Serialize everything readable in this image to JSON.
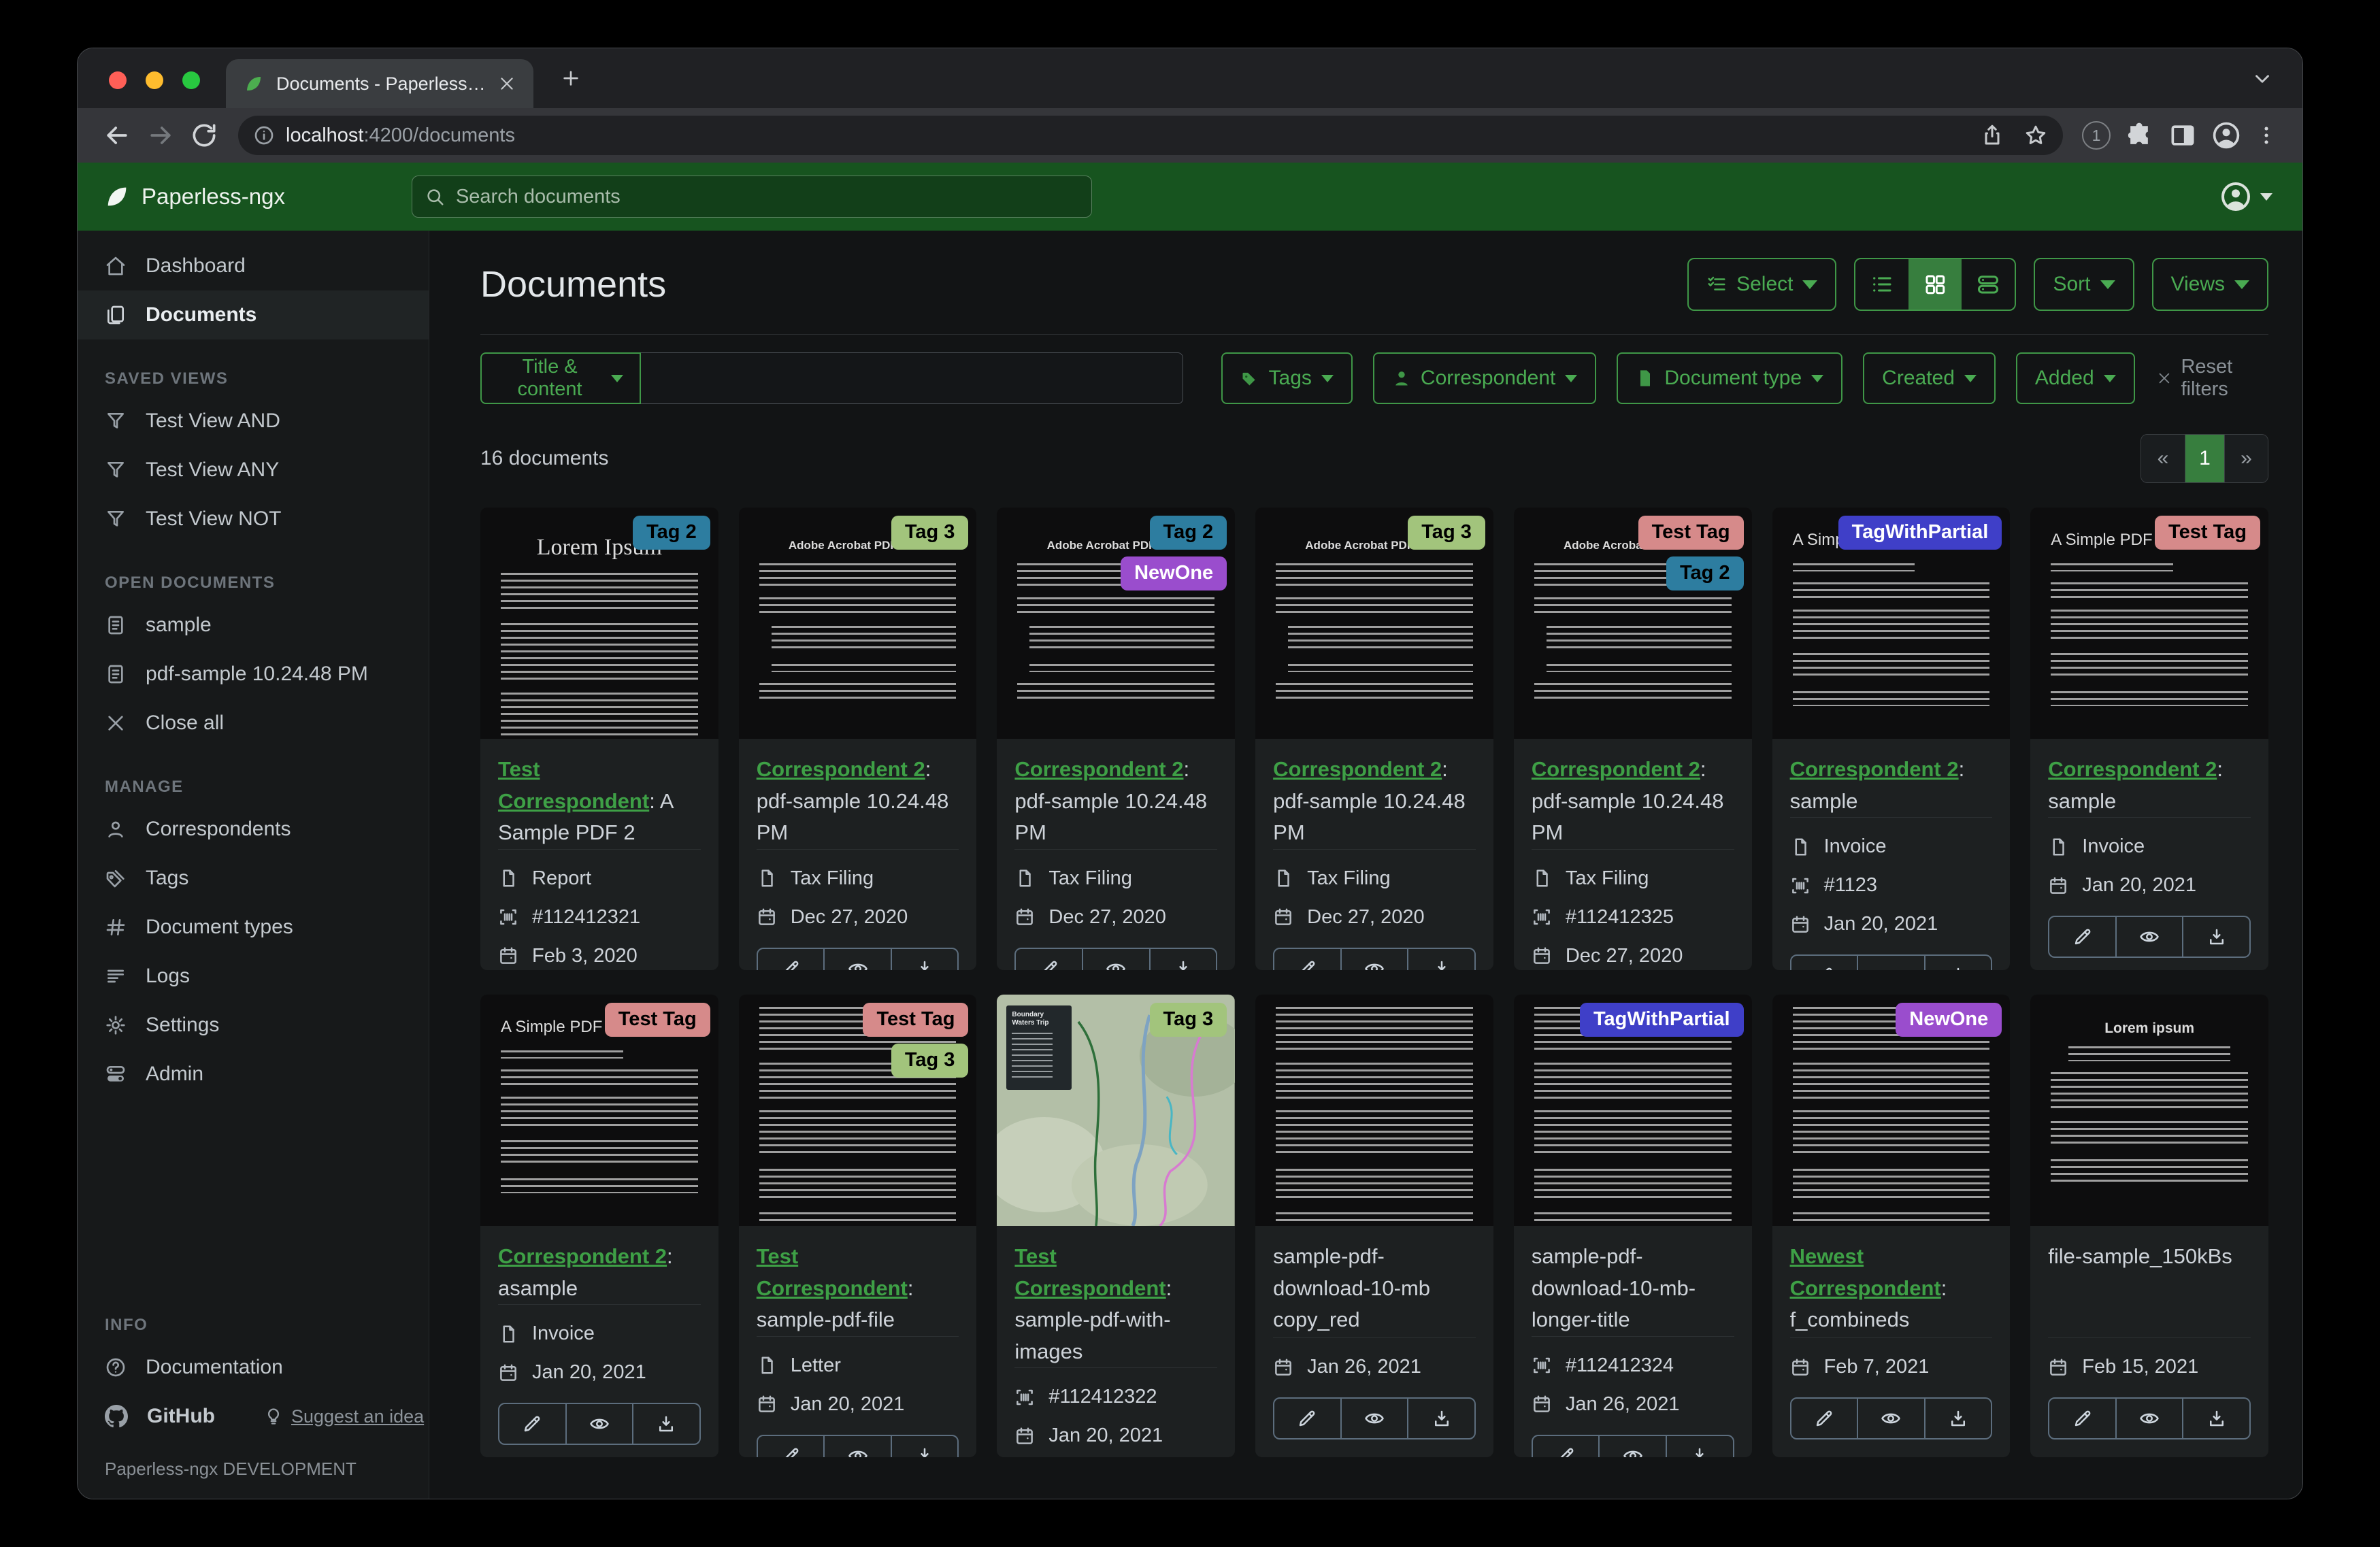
{
  "browser": {
    "tab_title": "Documents - Paperless-ngx",
    "url_host": "localhost",
    "url_rest": ":4200/documents",
    "ext_badge": "1"
  },
  "header": {
    "brand": "Paperless-ngx",
    "search_placeholder": "Search documents"
  },
  "sidebar": {
    "sections": [
      {
        "items": [
          {
            "icon": "home-icon",
            "label": "Dashboard"
          },
          {
            "icon": "documents-icon",
            "label": "Documents",
            "active": true
          }
        ]
      },
      {
        "title": "SAVED VIEWS",
        "items": [
          {
            "icon": "funnel-icon",
            "label": "Test View AND"
          },
          {
            "icon": "funnel-icon",
            "label": "Test View ANY"
          },
          {
            "icon": "funnel-icon",
            "label": "Test View NOT"
          }
        ]
      },
      {
        "title": "OPEN DOCUMENTS",
        "items": [
          {
            "icon": "file-text-icon",
            "label": "sample"
          },
          {
            "icon": "file-text-icon",
            "label": "pdf-sample 10.24.48 PM"
          },
          {
            "icon": "x-icon",
            "label": "Close all"
          }
        ]
      },
      {
        "title": "MANAGE",
        "items": [
          {
            "icon": "person-icon",
            "label": "Correspondents"
          },
          {
            "icon": "tags-icon",
            "label": "Tags"
          },
          {
            "icon": "hash-icon",
            "label": "Document types"
          },
          {
            "icon": "logs-icon",
            "label": "Logs"
          },
          {
            "icon": "gear-icon",
            "label": "Settings"
          },
          {
            "icon": "admin-icon",
            "label": "Admin"
          }
        ]
      }
    ],
    "info": {
      "title": "INFO",
      "documentation": {
        "icon": "question-icon",
        "label": "Documentation"
      },
      "github": {
        "icon": "github-icon",
        "label": "GitHub"
      },
      "suggest": {
        "icon": "bulb-icon",
        "label": "Suggest an idea"
      }
    },
    "footer": "Paperless-ngx DEVELOPMENT"
  },
  "toolbar": {
    "title": "Documents",
    "select_label": "Select",
    "sort_label": "Sort",
    "views_label": "Views"
  },
  "filters": {
    "field_label": "Title & content",
    "input_value": "",
    "buttons": [
      {
        "icon": "tag-filled-icon",
        "label": "Tags"
      },
      {
        "icon": "person-filled-icon",
        "label": "Correspondent"
      },
      {
        "icon": "file-filled-icon",
        "label": "Document type"
      },
      {
        "label": "Created"
      },
      {
        "label": "Added"
      }
    ],
    "reset_label": "Reset filters"
  },
  "status": {
    "count": "16 documents"
  },
  "pagination": {
    "prev": "«",
    "page": "1",
    "next": "»"
  },
  "theme": {
    "accent_green": "#43a047",
    "header_green": "#17541f",
    "active_green": "#377e3e"
  },
  "tag_colors": {
    "Tag 2": {
      "bg": "#2d7da0",
      "fg": "#000000"
    },
    "Tag 3": {
      "bg": "#a2c47c",
      "fg": "#000000"
    },
    "NewOne": {
      "bg": "#9a4dcd",
      "fg": "#ffffff"
    },
    "Test Tag": {
      "bg": "#d68a8a",
      "fg": "#000000"
    },
    "TagWithPartial": {
      "bg": "#3f3fc8",
      "fg": "#ffffff"
    }
  },
  "card_actions": [
    {
      "icon": "pencil-icon",
      "name": "edit-document-button"
    },
    {
      "icon": "eye-icon",
      "name": "view-document-button"
    },
    {
      "icon": "download-icon",
      "name": "download-document-button"
    }
  ],
  "cards": [
    {
      "tags": [
        "Tag 2"
      ],
      "thumb": {
        "kind": "lorem_serif",
        "heading": "Lorem Ipsum"
      },
      "title": {
        "link": "Test Correspondent",
        "rest": ": A Sample PDF 2"
      },
      "meta": [
        {
          "icon": "file-outline-icon",
          "text": "Report"
        },
        {
          "icon": "barcode-icon",
          "text": "#112412321"
        },
        {
          "icon": "calendar-icon",
          "text": "Feb 3, 2020"
        }
      ]
    },
    {
      "tags": [
        "Tag 3"
      ],
      "thumb": {
        "kind": "adobe",
        "heading": "Adobe Acrobat PDF Files"
      },
      "title": {
        "link": "Correspondent 2",
        "rest": ": pdf-sample 10.24.48 PM"
      },
      "meta": [
        {
          "icon": "file-outline-icon",
          "text": "Tax Filing"
        },
        {
          "icon": "calendar-icon",
          "text": "Dec 27, 2020"
        }
      ]
    },
    {
      "tags": [
        "Tag 2",
        "NewOne"
      ],
      "thumb": {
        "kind": "adobe",
        "heading": "Adobe Acrobat PDF Files"
      },
      "title": {
        "link": "Correspondent 2",
        "rest": ": pdf-sample 10.24.48 PM"
      },
      "meta": [
        {
          "icon": "file-outline-icon",
          "text": "Tax Filing"
        },
        {
          "icon": "calendar-icon",
          "text": "Dec 27, 2020"
        }
      ]
    },
    {
      "tags": [
        "Tag 3"
      ],
      "thumb": {
        "kind": "adobe",
        "heading": "Adobe Acrobat PDF Files"
      },
      "title": {
        "link": "Correspondent 2",
        "rest": ": pdf-sample 10.24.48 PM"
      },
      "meta": [
        {
          "icon": "file-outline-icon",
          "text": "Tax Filing"
        },
        {
          "icon": "calendar-icon",
          "text": "Dec 27, 2020"
        }
      ]
    },
    {
      "tags": [
        "Test Tag",
        "Tag 2"
      ],
      "thumb": {
        "kind": "adobe",
        "heading": "Adobe Acrobat PDF Files"
      },
      "title": {
        "link": "Correspondent 2",
        "rest": ": pdf-sample 10.24.48 PM"
      },
      "meta": [
        {
          "icon": "file-outline-icon",
          "text": "Tax Filing"
        },
        {
          "icon": "barcode-icon",
          "text": "#112412325"
        },
        {
          "icon": "calendar-icon",
          "text": "Dec 27, 2020"
        }
      ]
    },
    {
      "tags": [
        "TagWithPartial"
      ],
      "thumb": {
        "kind": "simple",
        "heading": "A Simple PDF File"
      },
      "title": {
        "link": "Correspondent 2",
        "rest": ": sample"
      },
      "meta": [
        {
          "icon": "file-outline-icon",
          "text": "Invoice"
        },
        {
          "icon": "barcode-icon",
          "text": "#1123"
        },
        {
          "icon": "calendar-icon",
          "text": "Jan 20, 2021"
        }
      ]
    },
    {
      "tags": [
        "Test Tag"
      ],
      "thumb": {
        "kind": "simple",
        "heading": "A Simple PDF File"
      },
      "title": {
        "link": "Correspondent 2",
        "rest": ": sample"
      },
      "meta": [
        {
          "icon": "file-outline-icon",
          "text": "Invoice"
        },
        {
          "icon": "calendar-icon",
          "text": "Jan 20, 2021"
        }
      ]
    },
    {
      "tags": [
        "Test Tag"
      ],
      "thumb": {
        "kind": "simple",
        "heading": "A Simple PDF File"
      },
      "title": {
        "link": "Correspondent 2",
        "rest": ": asample"
      },
      "meta": [
        {
          "icon": "file-outline-icon",
          "text": "Invoice"
        },
        {
          "icon": "calendar-icon",
          "text": "Jan 20, 2021"
        }
      ]
    },
    {
      "tags": [
        "Test Tag",
        "Tag 3"
      ],
      "thumb": {
        "kind": "dense",
        "heading": ""
      },
      "title": {
        "link": "Test Correspondent",
        "rest": ": sample-pdf-file"
      },
      "meta": [
        {
          "icon": "file-outline-icon",
          "text": "Letter"
        },
        {
          "icon": "calendar-icon",
          "text": "Jan 20, 2021"
        }
      ]
    },
    {
      "tags": [
        "Tag 3"
      ],
      "thumb": {
        "kind": "map",
        "heading": "Boundary Waters Trip"
      },
      "title": {
        "link": "Test Correspondent",
        "rest": ": sample-pdf-with-images"
      },
      "meta": [
        {
          "icon": "barcode-icon",
          "text": "#112412322"
        },
        {
          "icon": "calendar-icon",
          "text": "Jan 20, 2021"
        }
      ]
    },
    {
      "tags": [],
      "thumb": {
        "kind": "dense",
        "heading": ""
      },
      "title": {
        "plain": "sample-pdf-download-10-mb copy_red"
      },
      "meta": [
        {
          "icon": "calendar-icon",
          "text": "Jan 26, 2021"
        }
      ]
    },
    {
      "tags": [
        "TagWithPartial"
      ],
      "thumb": {
        "kind": "dense",
        "heading": ""
      },
      "title": {
        "plain": "sample-pdf-download-10-mb-longer-title"
      },
      "meta": [
        {
          "icon": "barcode-icon",
          "text": "#112412324"
        },
        {
          "icon": "calendar-icon",
          "text": "Jan 26, 2021"
        }
      ]
    },
    {
      "tags": [
        "NewOne"
      ],
      "thumb": {
        "kind": "dense",
        "heading": ""
      },
      "title": {
        "link": "Newest Correspondent",
        "rest": ": f_combineds"
      },
      "meta": [
        {
          "icon": "calendar-icon",
          "text": "Feb 7, 2021"
        }
      ]
    },
    {
      "tags": [],
      "thumb": {
        "kind": "center",
        "heading": "Lorem ipsum"
      },
      "title": {
        "plain": "file-sample_150kBs"
      },
      "meta": [
        {
          "icon": "calendar-icon",
          "text": "Feb 15, 2021"
        }
      ]
    }
  ]
}
